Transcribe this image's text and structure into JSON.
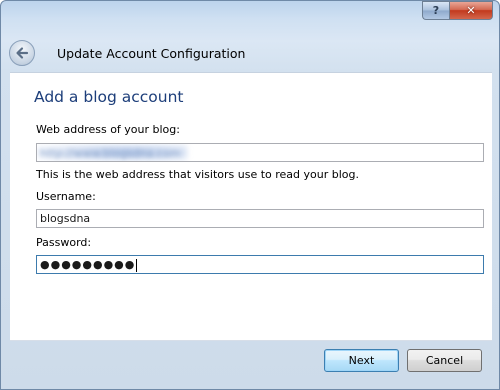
{
  "titlebar": {
    "help_label": "?",
    "close_label": "✕"
  },
  "header": {
    "back_icon": "back-arrow-icon",
    "title": "Update Account Configuration"
  },
  "form": {
    "heading": "Add a blog account",
    "web_address_label": "Web address of your blog:",
    "web_address_value": "http://www.blogsdna.com",
    "web_address_hint": "This is the web address that visitors use to read your blog.",
    "username_label": "Username:",
    "username_value": "blogsdna",
    "password_label": "Password:",
    "password_value": "●●●●●●●●●"
  },
  "buttons": {
    "next_label": "Next",
    "cancel_label": "Cancel"
  },
  "colors": {
    "heading": "#1d3e7a",
    "title_bar": "#cfe0f2",
    "default_button": "#bee6fd"
  }
}
